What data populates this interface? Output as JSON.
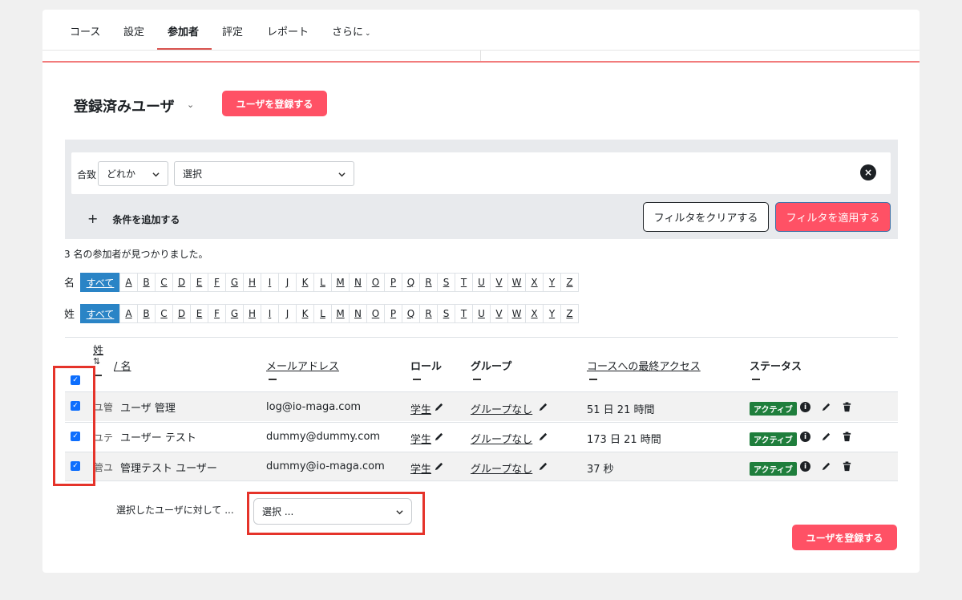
{
  "nav": {
    "tabs": [
      {
        "label": "コース"
      },
      {
        "label": "設定"
      },
      {
        "label": "参加者"
      },
      {
        "label": "評定"
      },
      {
        "label": "レポート"
      },
      {
        "label": "さらに"
      }
    ]
  },
  "page": {
    "title": "登録済みユーザ",
    "enrol_button": "ユーザを登録する"
  },
  "filter": {
    "match_label": "合致",
    "match_value": "どれか",
    "condition_value": "選択",
    "add_condition": "条件を追加する",
    "clear_button": "フィルタをクリアする",
    "apply_button": "フィルタを適用する"
  },
  "results_text": "3 名の参加者が見つかりました。",
  "initials": {
    "first_label": "名",
    "last_label": "姓",
    "all_label": "すべて",
    "letters": [
      "A",
      "B",
      "C",
      "D",
      "E",
      "F",
      "G",
      "H",
      "I",
      "J",
      "K",
      "L",
      "M",
      "N",
      "O",
      "P",
      "Q",
      "R",
      "S",
      "T",
      "U",
      "V",
      "W",
      "X",
      "Y",
      "Z"
    ]
  },
  "table": {
    "headers": {
      "lastname": "姓",
      "firstname": "/ 名",
      "email": "メールアドレス",
      "roles": "ロール",
      "groups": "グループ",
      "lastaccess": "コースへの最終アクセス",
      "status": "ステータス"
    },
    "rows": [
      {
        "initials": "ユ管",
        "name": "ユーザ 管理",
        "email": "log@io-maga.com",
        "role": "学生",
        "group": "グループなし",
        "lastaccess": "51 日 21 時間",
        "status": "アクティブ",
        "checked": true
      },
      {
        "initials": "ユテ",
        "name": "ユーザー テスト",
        "email": "dummy@dummy.com",
        "role": "学生",
        "group": "グループなし",
        "lastaccess": "173 日 21 時間",
        "status": "アクティブ",
        "checked": true
      },
      {
        "initials": "管ユ",
        "name": "管理テスト ユーザー",
        "email": "dummy@io-maga.com",
        "role": "学生",
        "group": "グループなし",
        "lastaccess": "37 秒",
        "status": "アクティブ",
        "checked": true
      }
    ]
  },
  "bulk": {
    "label": "選択したユーザに対して ...",
    "select_value": "選択 ..."
  },
  "colors": {
    "accent": "#ff5165",
    "highlight": "#e5332a",
    "active_badge": "#1f7e3c",
    "initial_all": "#2a84c6"
  }
}
